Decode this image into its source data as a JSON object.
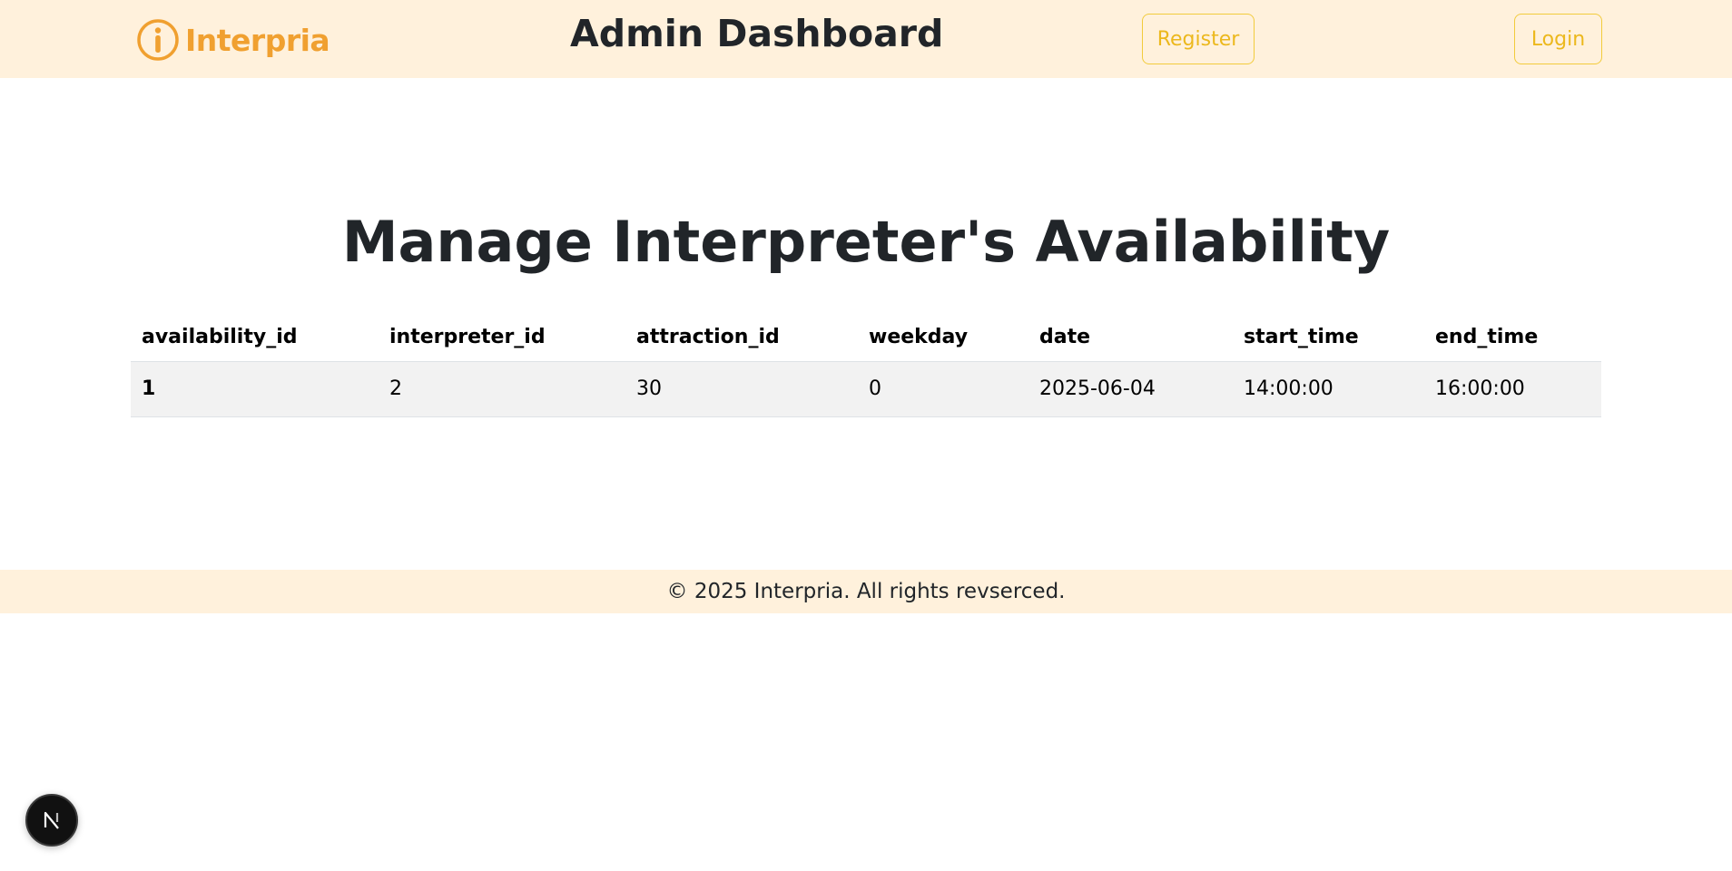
{
  "header": {
    "logo_text": "Interpria",
    "title": "Admin Dashboard",
    "register_label": "Register",
    "login_label": "Login"
  },
  "main": {
    "heading": "Manage Interpreter's Availability",
    "table": {
      "columns": [
        "availability_id",
        "interpreter_id",
        "attraction_id",
        "weekday",
        "date",
        "start_time",
        "end_time"
      ],
      "rows": [
        [
          "1",
          "2",
          "30",
          "0",
          "2025-06-04",
          "14:00:00",
          "16:00:00"
        ]
      ]
    }
  },
  "footer": {
    "text": "© 2025 Interpria. All rights revserced."
  },
  "colors": {
    "header_bg": "#fff1dc",
    "brand": "#f0a030",
    "button_outline": "#f2cb3c",
    "row_bg": "#f2f2f2"
  },
  "icons": {
    "logo": "info-circle-icon",
    "dev_badge": "nextjs-logo-icon"
  }
}
